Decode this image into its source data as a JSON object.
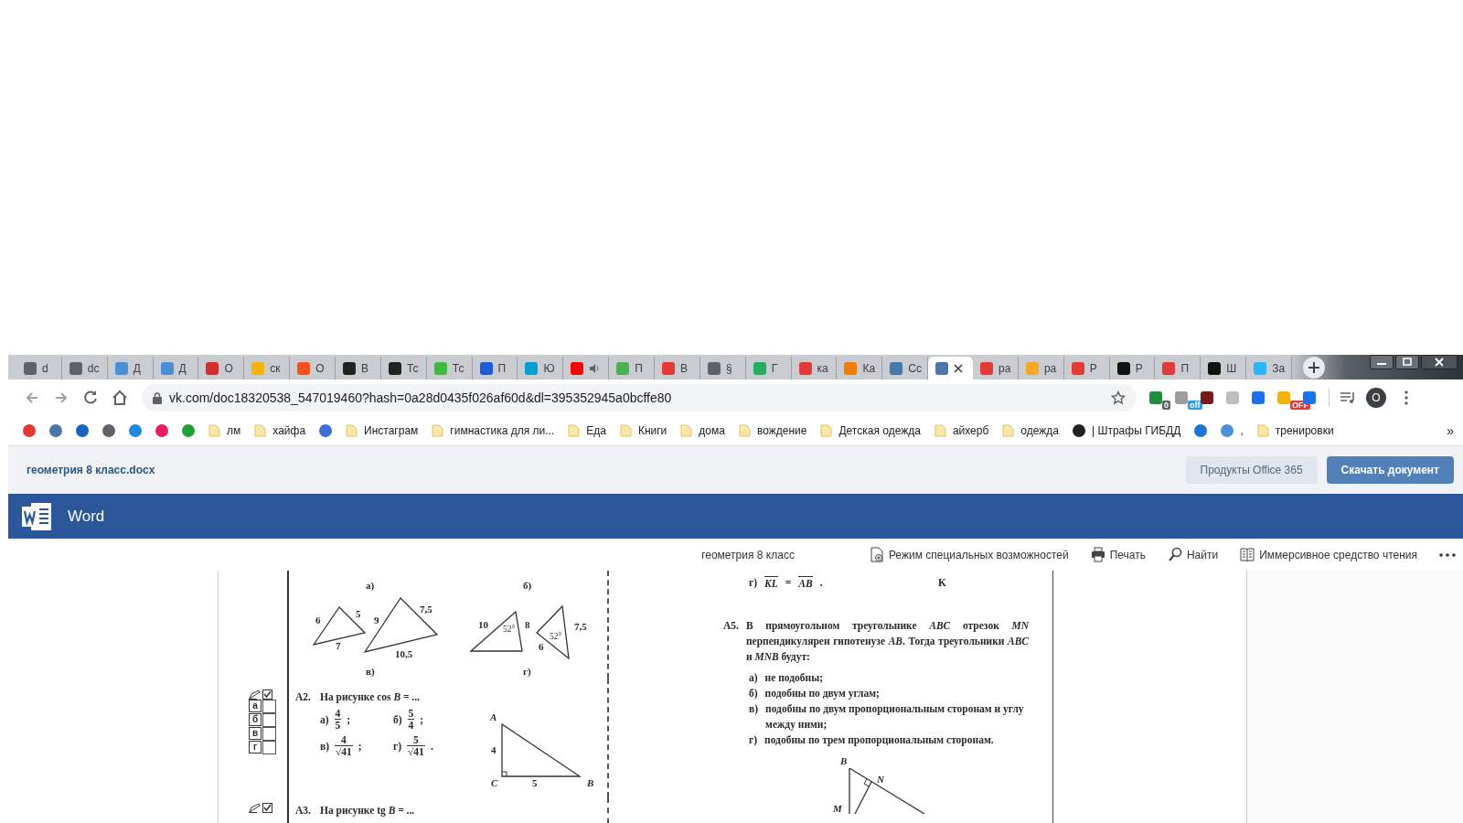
{
  "tabs": [
    {
      "title": "d",
      "color": "#5f6368",
      "audio": false,
      "selected": false
    },
    {
      "title": "dc",
      "color": "#5f6368",
      "audio": false,
      "selected": false
    },
    {
      "title": "Д",
      "color": "#4a90d9",
      "audio": false,
      "selected": false
    },
    {
      "title": "Д",
      "color": "#4a90d9",
      "audio": false,
      "selected": false
    },
    {
      "title": "О",
      "color": "#d32f2f",
      "audio": false,
      "selected": false
    },
    {
      "title": "ск",
      "color": "#f5b400",
      "audio": false,
      "selected": false
    },
    {
      "title": "О",
      "color": "#f4511e",
      "audio": false,
      "selected": false
    },
    {
      "title": "В",
      "color": "#222222",
      "audio": false,
      "selected": false
    },
    {
      "title": "Тс",
      "color": "#222222",
      "audio": false,
      "selected": false
    },
    {
      "title": "Тс",
      "color": "#3dbb3d",
      "audio": false,
      "selected": false
    },
    {
      "title": "П",
      "color": "#1e5bd8",
      "audio": false,
      "selected": false
    },
    {
      "title": "Ю",
      "color": "#00a0d2",
      "audio": false,
      "selected": false
    },
    {
      "color": "#ff0000",
      "audio": true,
      "selected": false
    },
    {
      "title": "П",
      "color": "#4caf50",
      "audio": false,
      "selected": false
    },
    {
      "title": "В",
      "color": "#e53935",
      "audio": false,
      "selected": false
    },
    {
      "title": "§",
      "color": "#5f6368",
      "audio": false,
      "selected": false
    },
    {
      "title": "Г",
      "color": "#27ae60",
      "audio": false,
      "selected": false
    },
    {
      "title": "ка",
      "color": "#e53935",
      "audio": false,
      "selected": false
    },
    {
      "title": "Ка",
      "color": "#f57c00",
      "audio": false,
      "selected": false
    },
    {
      "title": "Сс",
      "color": "#4a76a8",
      "audio": false,
      "selected": false
    },
    {
      "color": "#4a76a8",
      "audio": false,
      "selected": true
    },
    {
      "title": "ра",
      "color": "#e53935",
      "audio": false,
      "selected": false
    },
    {
      "title": "ра",
      "color": "#f9a825",
      "audio": false,
      "selected": false
    },
    {
      "title": "Р",
      "color": "#e53935",
      "audio": false,
      "selected": false
    },
    {
      "title": "Р",
      "color": "#111111",
      "audio": false,
      "selected": false
    },
    {
      "title": "П",
      "color": "#e53935",
      "audio": false,
      "selected": false
    },
    {
      "title": "Ш",
      "color": "#111111",
      "audio": false,
      "selected": false
    },
    {
      "title": "За",
      "color": "#29b6f6",
      "audio": false,
      "selected": false
    }
  ],
  "address_bar": {
    "url": "vk.com/doc18320538_547019460?hash=0a28d0435f026af60d&dl=395352945a0bcffe80"
  },
  "extensions": [
    {
      "color": "#1e8e3e",
      "badge": {
        "text": "0",
        "color": "#5f6368"
      }
    },
    {
      "color": "#9e9e9e",
      "badge": {
        "text": "off",
        "color": "#2f9be0"
      }
    },
    {
      "color": "#7a1a1a"
    },
    {
      "color": "#bdbdbd"
    },
    {
      "color": "#1a73e8"
    },
    {
      "color": "#f4b400",
      "badge": {
        "text": "OFF",
        "color": "#e53935"
      }
    },
    {
      "color": "#1a73e8"
    }
  ],
  "profile": {
    "initial": "O"
  },
  "bookmarks": [
    {
      "kind": "site",
      "color": "#e53935"
    },
    {
      "kind": "site",
      "color": "#4a76a8"
    },
    {
      "kind": "site",
      "color": "#1565c0"
    },
    {
      "kind": "site",
      "color": "#5f6368"
    },
    {
      "kind": "site",
      "color": "#1e88e5"
    },
    {
      "kind": "site",
      "color": "#e91e63"
    },
    {
      "kind": "site",
      "color": "#21a038"
    },
    {
      "kind": "folder",
      "label": "лм"
    },
    {
      "kind": "folder",
      "label": "хайфа"
    },
    {
      "kind": "site",
      "color": "#3f6fd8"
    },
    {
      "kind": "folder",
      "label": "Инстаграм"
    },
    {
      "kind": "folder",
      "label": "гимнастика для ли..."
    },
    {
      "kind": "folder",
      "label": "Еда"
    },
    {
      "kind": "folder",
      "label": "Книги"
    },
    {
      "kind": "folder",
      "label": "дома"
    },
    {
      "kind": "folder",
      "label": "вождение"
    },
    {
      "kind": "folder",
      "label": "Детская одежда"
    },
    {
      "kind": "folder",
      "label": "айхерб"
    },
    {
      "kind": "folder",
      "label": "одежда"
    },
    {
      "kind": "site",
      "color": "#222222",
      "label": "| Штрафы ГИБДД"
    },
    {
      "kind": "site",
      "color": "#1976d2"
    },
    {
      "kind": "site",
      "color": "#4a90d9",
      "label": ","
    },
    {
      "kind": "folder",
      "label": "тренировки"
    }
  ],
  "bookmarks_more": "»",
  "doc_header": {
    "filename": "геометрия 8 класс.docx",
    "buttons": [
      {
        "label": "Продукты Office 365",
        "kind": "secondary"
      },
      {
        "label": "Скачать документ",
        "kind": "primary"
      }
    ]
  },
  "app_bar": {
    "name": "Word"
  },
  "toolbar": {
    "doc_title": "геометрия 8 класс",
    "actions": [
      {
        "kind": "accessibility",
        "label": "Режим специальных возможностей"
      },
      {
        "kind": "print",
        "label": "Печать"
      },
      {
        "kind": "find",
        "label": "Найти"
      },
      {
        "kind": "reader",
        "label": "Иммерсивное средство чтения"
      }
    ]
  },
  "page": {
    "figure": {
      "captions": [
        "а)",
        "б)",
        "в)",
        "г)"
      ],
      "labels": [
        {
          "kind": "side",
          "text": "6"
        },
        {
          "kind": "side",
          "text": "5"
        },
        {
          "kind": "side",
          "text": "7"
        },
        {
          "kind": "side",
          "text": "9"
        },
        {
          "kind": "side",
          "text": "7,5"
        },
        {
          "kind": "side",
          "text": "10,5"
        },
        {
          "kind": "side",
          "text": "10"
        },
        {
          "kind": "angle",
          "text": "52°"
        },
        {
          "kind": "side",
          "text": "8"
        },
        {
          "kind": "side",
          "text": "7,5"
        },
        {
          "kind": "side",
          "text": "6"
        },
        {
          "kind": "angle",
          "text": "52°"
        }
      ]
    },
    "questions_left": [
      {
        "number": "A2.",
        "text": "На рисунке cos *B* = ...",
        "answer_key": [
          {
            "letter": "а",
            "checked": false
          },
          {
            "letter": "б",
            "checked": false
          },
          {
            "letter": "в",
            "checked": false
          },
          {
            "letter": "г",
            "checked": false
          }
        ],
        "options": [
          {
            "letter": "а)",
            "numerator": "4",
            "denominator": "5",
            "end": ";"
          },
          {
            "letter": "б)",
            "numerator": "5",
            "denominator": "4",
            "end": ";"
          },
          {
            "letter": "в)",
            "numerator": "4",
            "denominator": "√41",
            "end": ";"
          },
          {
            "letter": "г)",
            "numerator": "5",
            "denominator": "√41",
            "end": "."
          }
        ],
        "triangle_labels": [
          "A",
          "4",
          "C",
          "5",
          "B"
        ]
      },
      {
        "number": "A3.",
        "text": "На рисунке tg *B* = ..."
      }
    ],
    "previous_option": {
      "letter": "г)",
      "terms": [
        "KL",
        "AB"
      ],
      "operator": "=",
      "end": ".",
      "figure_label": "K"
    },
    "question_right": {
      "number": "A5.",
      "text": "В прямоугольном треугольнике *ABC* отрезок *MN* перпендикулярен гипотенузе *AB*. Тогда треугольники *ABC* и *MNB* будут:",
      "options": [
        {
          "letter": "а)",
          "text": "не подобны;"
        },
        {
          "letter": "б)",
          "text": "подобны по двум углам;"
        },
        {
          "letter": "в)",
          "text": "подобны по двум пропорциональным сторонам и углу между ними;"
        },
        {
          "letter": "г)",
          "text": "подобны по трем пропорциональным сторонам."
        }
      ],
      "triangle_labels": [
        "B",
        "N",
        "M"
      ]
    }
  }
}
